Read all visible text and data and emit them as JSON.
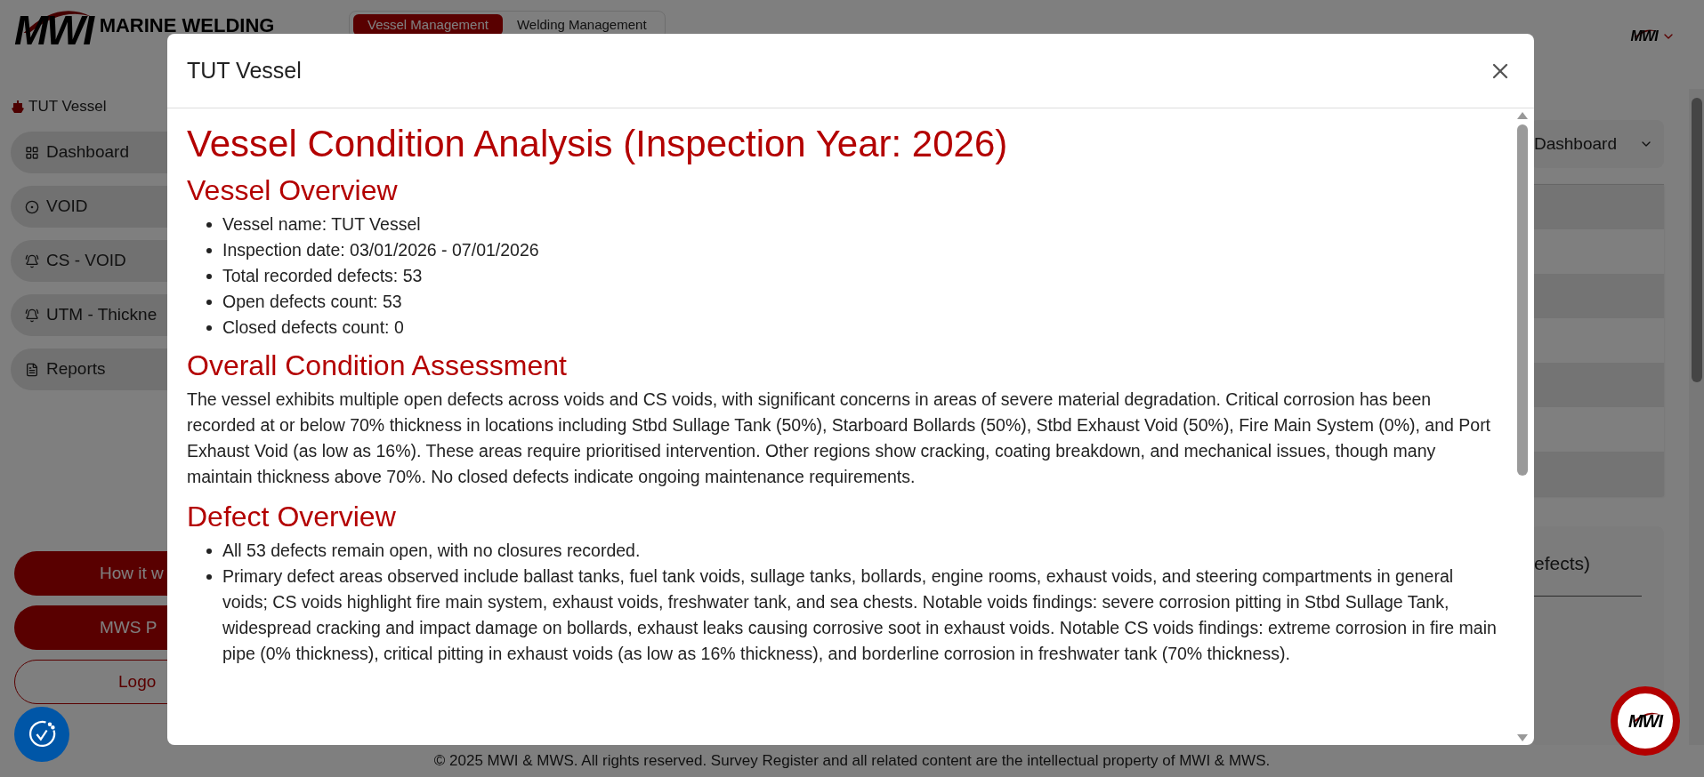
{
  "header": {
    "logo_mark": "MWI",
    "logo_text": "MARINE WELDING",
    "tabs": [
      {
        "label": "Vessel Management",
        "selected": true
      },
      {
        "label": "Welding Management",
        "selected": false
      }
    ],
    "account_logo": "MWI"
  },
  "sidebar": {
    "vessel": "TUT Vessel",
    "items": [
      {
        "label": "Dashboard",
        "kind": "grid"
      },
      {
        "label": "VOID",
        "kind": "ring"
      },
      {
        "label": "CS - VOID",
        "kind": "dome"
      },
      {
        "label": "UTM - Thickne",
        "kind": "dome"
      },
      {
        "label": "Reports",
        "kind": "document"
      }
    ],
    "buttons": [
      {
        "label": "How it w",
        "kind": "filled"
      },
      {
        "label": "MWS P",
        "kind": "filled"
      },
      {
        "label": "Logo",
        "kind": "outline"
      }
    ]
  },
  "main": {
    "dropdown": "Dashboard",
    "card_title": "efects)"
  },
  "modal": {
    "title": "TUT Vessel",
    "heading": "Vessel Condition Analysis (Inspection Year: 2026)",
    "sections": [
      {
        "title": "Vessel Overview",
        "kind": "list",
        "items": [
          "Vessel name: TUT Vessel",
          "Inspection date: 03/01/2026 - 07/01/2026",
          "Total recorded defects: 53",
          "Open defects count: 53",
          "Closed defects count: 0"
        ]
      },
      {
        "title": "Overall Condition Assessment",
        "kind": "paragraph",
        "text": "The vessel exhibits multiple open defects across voids and CS voids, with significant concerns in areas of severe material degradation. Critical corrosion has been recorded at or below 70% thickness in locations including Stbd Sullage Tank (50%), Starboard Bollards (50%), Stbd Exhaust Void (50%), Fire Main System (0%), and Port Exhaust Void (as low as 16%). These areas require prioritised intervention. Other regions show cracking, coating breakdown, and mechanical issues, though many maintain thickness above 70%. No closed defects indicate ongoing maintenance requirements."
      },
      {
        "title": "Defect Overview",
        "kind": "list",
        "items": [
          "All 53 defects remain open, with no closures recorded.",
          "Primary defect areas observed include ballast tanks, fuel tank voids, sullage tanks, bollards, engine rooms, exhaust voids, and steering compartments in general voids; CS voids highlight fire main system, exhaust voids, freshwater tank, and sea chests. Notable voids findings: severe corrosion pitting in Stbd Sullage Tank, widespread cracking and impact damage on bollards, exhaust leaks causing corrosive soot in exhaust voids. Notable CS voids findings: extreme corrosion in fire main pipe (0% thickness), critical pitting in exhaust voids (as low as 16% thickness), and borderline corrosion in freshwater tank (70% thickness)."
        ]
      }
    ]
  },
  "fab_logo": "MWI",
  "footer": "© 2025 MWI & MWS. All rights reserved. Survey Register and all related content are the intellectual property of MWI & MWS."
}
